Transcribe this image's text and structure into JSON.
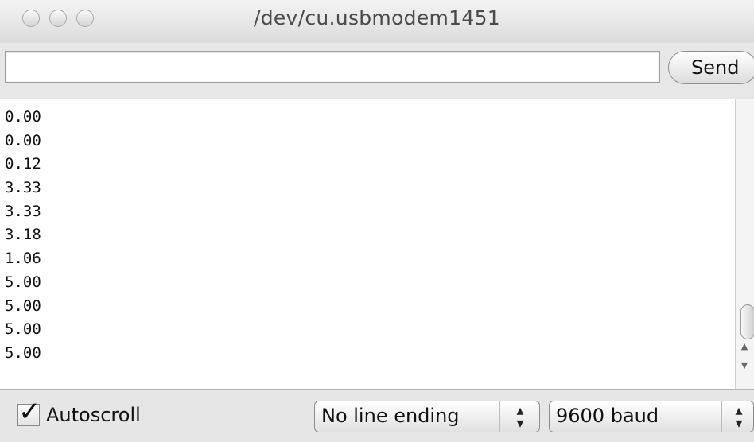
{
  "window": {
    "title": "/dev/cu.usbmodem1451"
  },
  "input_row": {
    "input_value": "",
    "send_label": "Send"
  },
  "output": {
    "lines": [
      "0.00",
      "0.00",
      "0.12",
      "3.33",
      "3.33",
      "3.18",
      "1.06",
      "5.00",
      "5.00",
      "5.00",
      "5.00"
    ]
  },
  "footer": {
    "autoscroll_label": "Autoscroll",
    "autoscroll_checked": true,
    "line_ending": "No line ending",
    "baud": "9600 baud"
  },
  "icons": {
    "check_glyph": "✓",
    "updown_glyph": "▴▾"
  }
}
